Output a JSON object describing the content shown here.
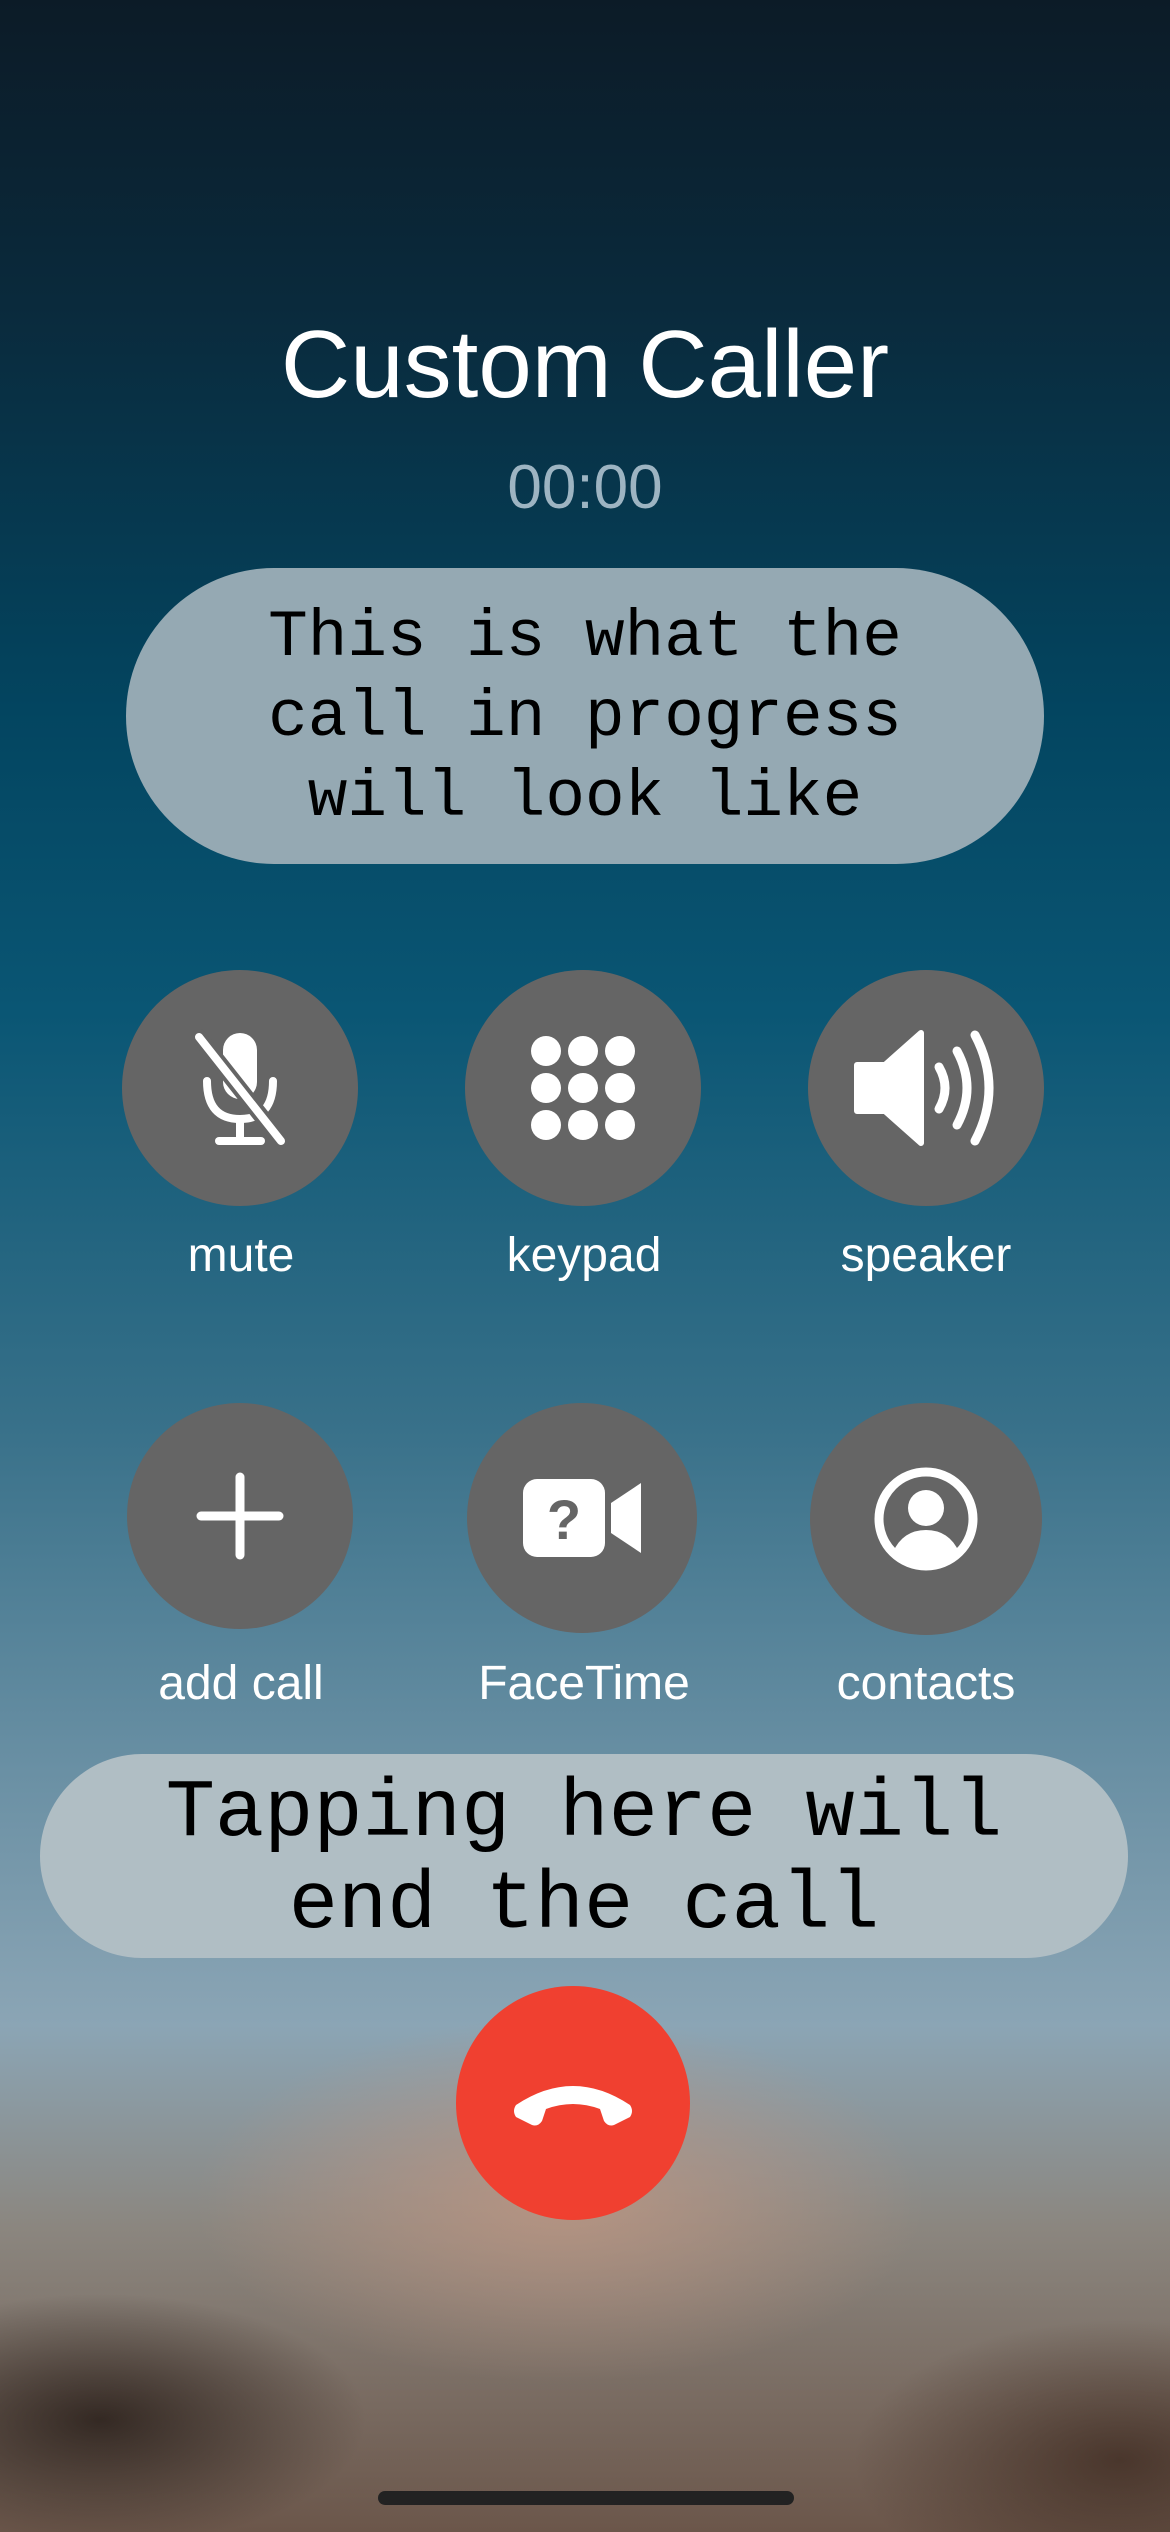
{
  "call": {
    "caller_name": "Custom Caller",
    "timer": "00:00"
  },
  "hints": {
    "top_lines": [
      "This is what the",
      "call in progress",
      "will look like"
    ],
    "bottom_lines": [
      "Tapping here will",
      "end the call"
    ]
  },
  "controls": {
    "mute_label": "mute",
    "keypad_label": "keypad",
    "speaker_label": "speaker",
    "add_call_label": "add call",
    "facetime_label": "FaceTime",
    "contacts_label": "contacts"
  },
  "icons": {
    "mute": "mic-slash-icon",
    "keypad": "keypad-grid-icon",
    "speaker": "speaker-wave-icon",
    "add_call": "plus-icon",
    "facetime": "video-question-icon",
    "contacts": "person-circle-icon",
    "end_call": "phone-down-icon"
  },
  "colors": {
    "end_call": "#f04030",
    "control_button": "#656565"
  }
}
